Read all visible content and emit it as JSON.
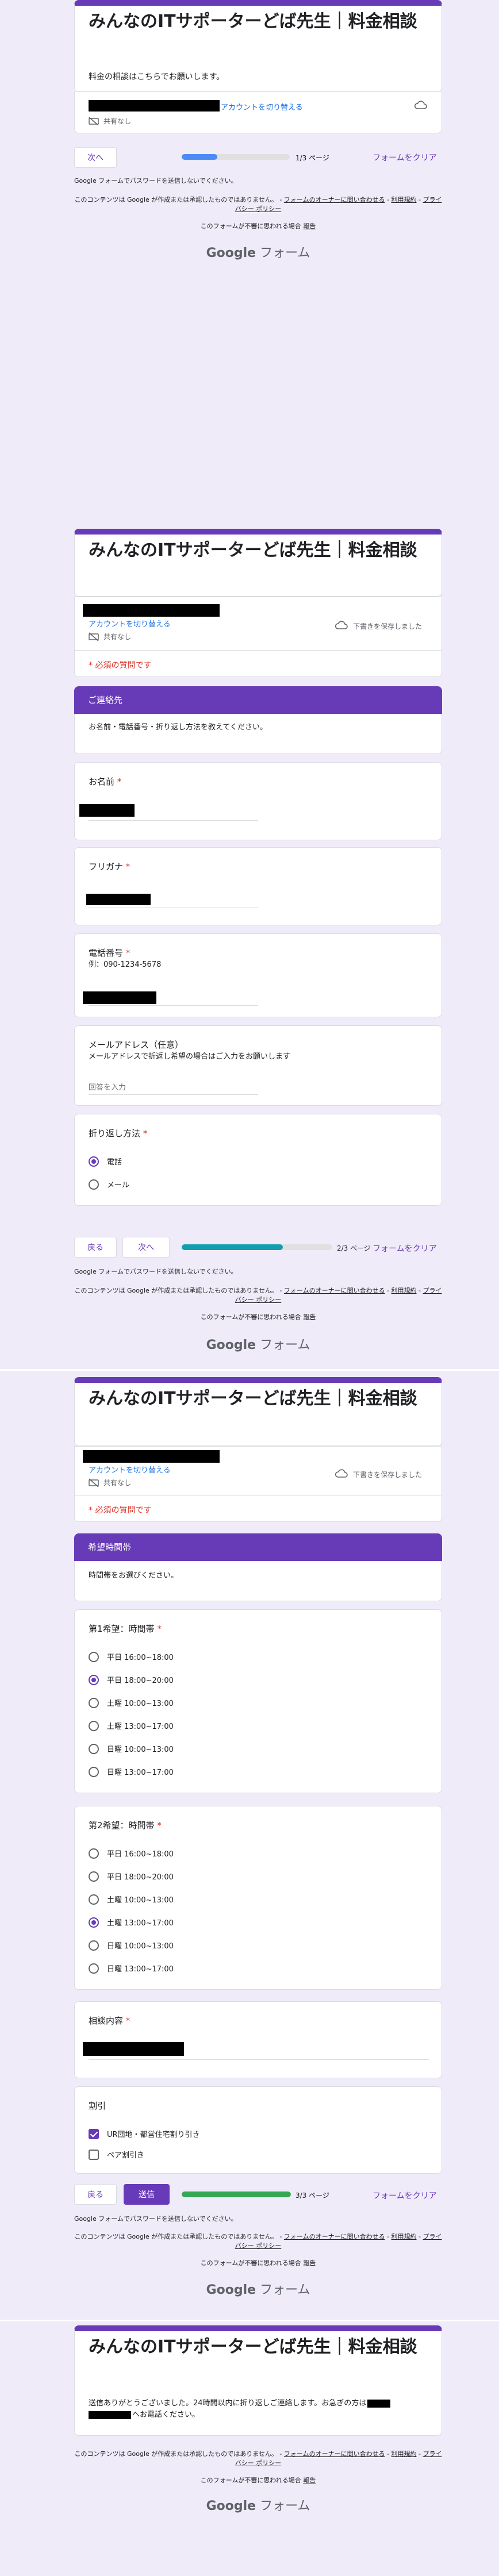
{
  "form": {
    "title": "みんなのITサポーターどば先生｜料金相談",
    "intro": "料金の相談はこちらでお願いします。",
    "switch_account": "アカウントを切り替える",
    "not_shared": "共有なし",
    "draft_saved": "下書きを保存しました",
    "required_note": "* 必須の質問です",
    "no_password_note": "Google フォームでパスワードを送信しないでください。",
    "footer_line1": "このコンテンツは Google が作成または承認したものではありません。",
    "footer_owner_link": "フォームのオーナーに問い合わせる",
    "footer_terms": "利用規約",
    "footer_privacy": "プライバシー ポリシー",
    "footer_suspicious": "このフォームが不審に思われる場合",
    "footer_report": "報告",
    "logo_google": "Google",
    "logo_forms": "フォーム"
  },
  "nav": {
    "next": "次へ",
    "back": "戻る",
    "submit": "送信",
    "clear": "フォームをクリア"
  },
  "pages": [
    {
      "label": "1/3 ページ",
      "progress": 0.33,
      "color": "#4c8bf5"
    },
    {
      "label": "2/3 ページ",
      "progress": 0.67,
      "color": "#129eaf"
    },
    {
      "label": "3/3 ページ",
      "progress": 1.0,
      "color": "#34a853"
    }
  ],
  "contact_section": {
    "heading": "ご連絡先",
    "description": "お名前・電話番号・折り返し方法を教えてください。",
    "name_q": "お名前",
    "furigana_q": "フリガナ",
    "phone_q": "電話番号",
    "phone_hint": "例：090-1234-5678",
    "email_q": "メールアドレス（任意）",
    "email_hint": "メールアドレスで折返し希望の場合はご入力をお願いします",
    "email_placeholder": "回答を入力",
    "callback_q": "折り返し方法",
    "callback_options": [
      "電話",
      "メール"
    ],
    "callback_selected": 0
  },
  "time_section": {
    "heading": "希望時間帯",
    "description": "時間帯をお選びください。",
    "first_q": "第1希望：時間帯",
    "second_q": "第2希望：時間帯",
    "options": [
      "平日 16:00~18:00",
      "平日 18:00~20:00",
      "土曜 10:00~13:00",
      "土曜 13:00~17:00",
      "日曜 10:00~13:00",
      "日曜 13:00~17:00"
    ],
    "first_selected": 1,
    "second_selected": 3,
    "consult_q": "相談内容",
    "discount_q": "割引",
    "discount_options": [
      "UR団地・都営住宅割り引き",
      "ペア割引き"
    ],
    "discount_checked": [
      true,
      false
    ]
  },
  "thanks": {
    "message_part1": "送信ありがとうございました。24時間以内に折り返しご連絡します。お急ぎの方は",
    "message_part2": "へお電話ください。"
  }
}
